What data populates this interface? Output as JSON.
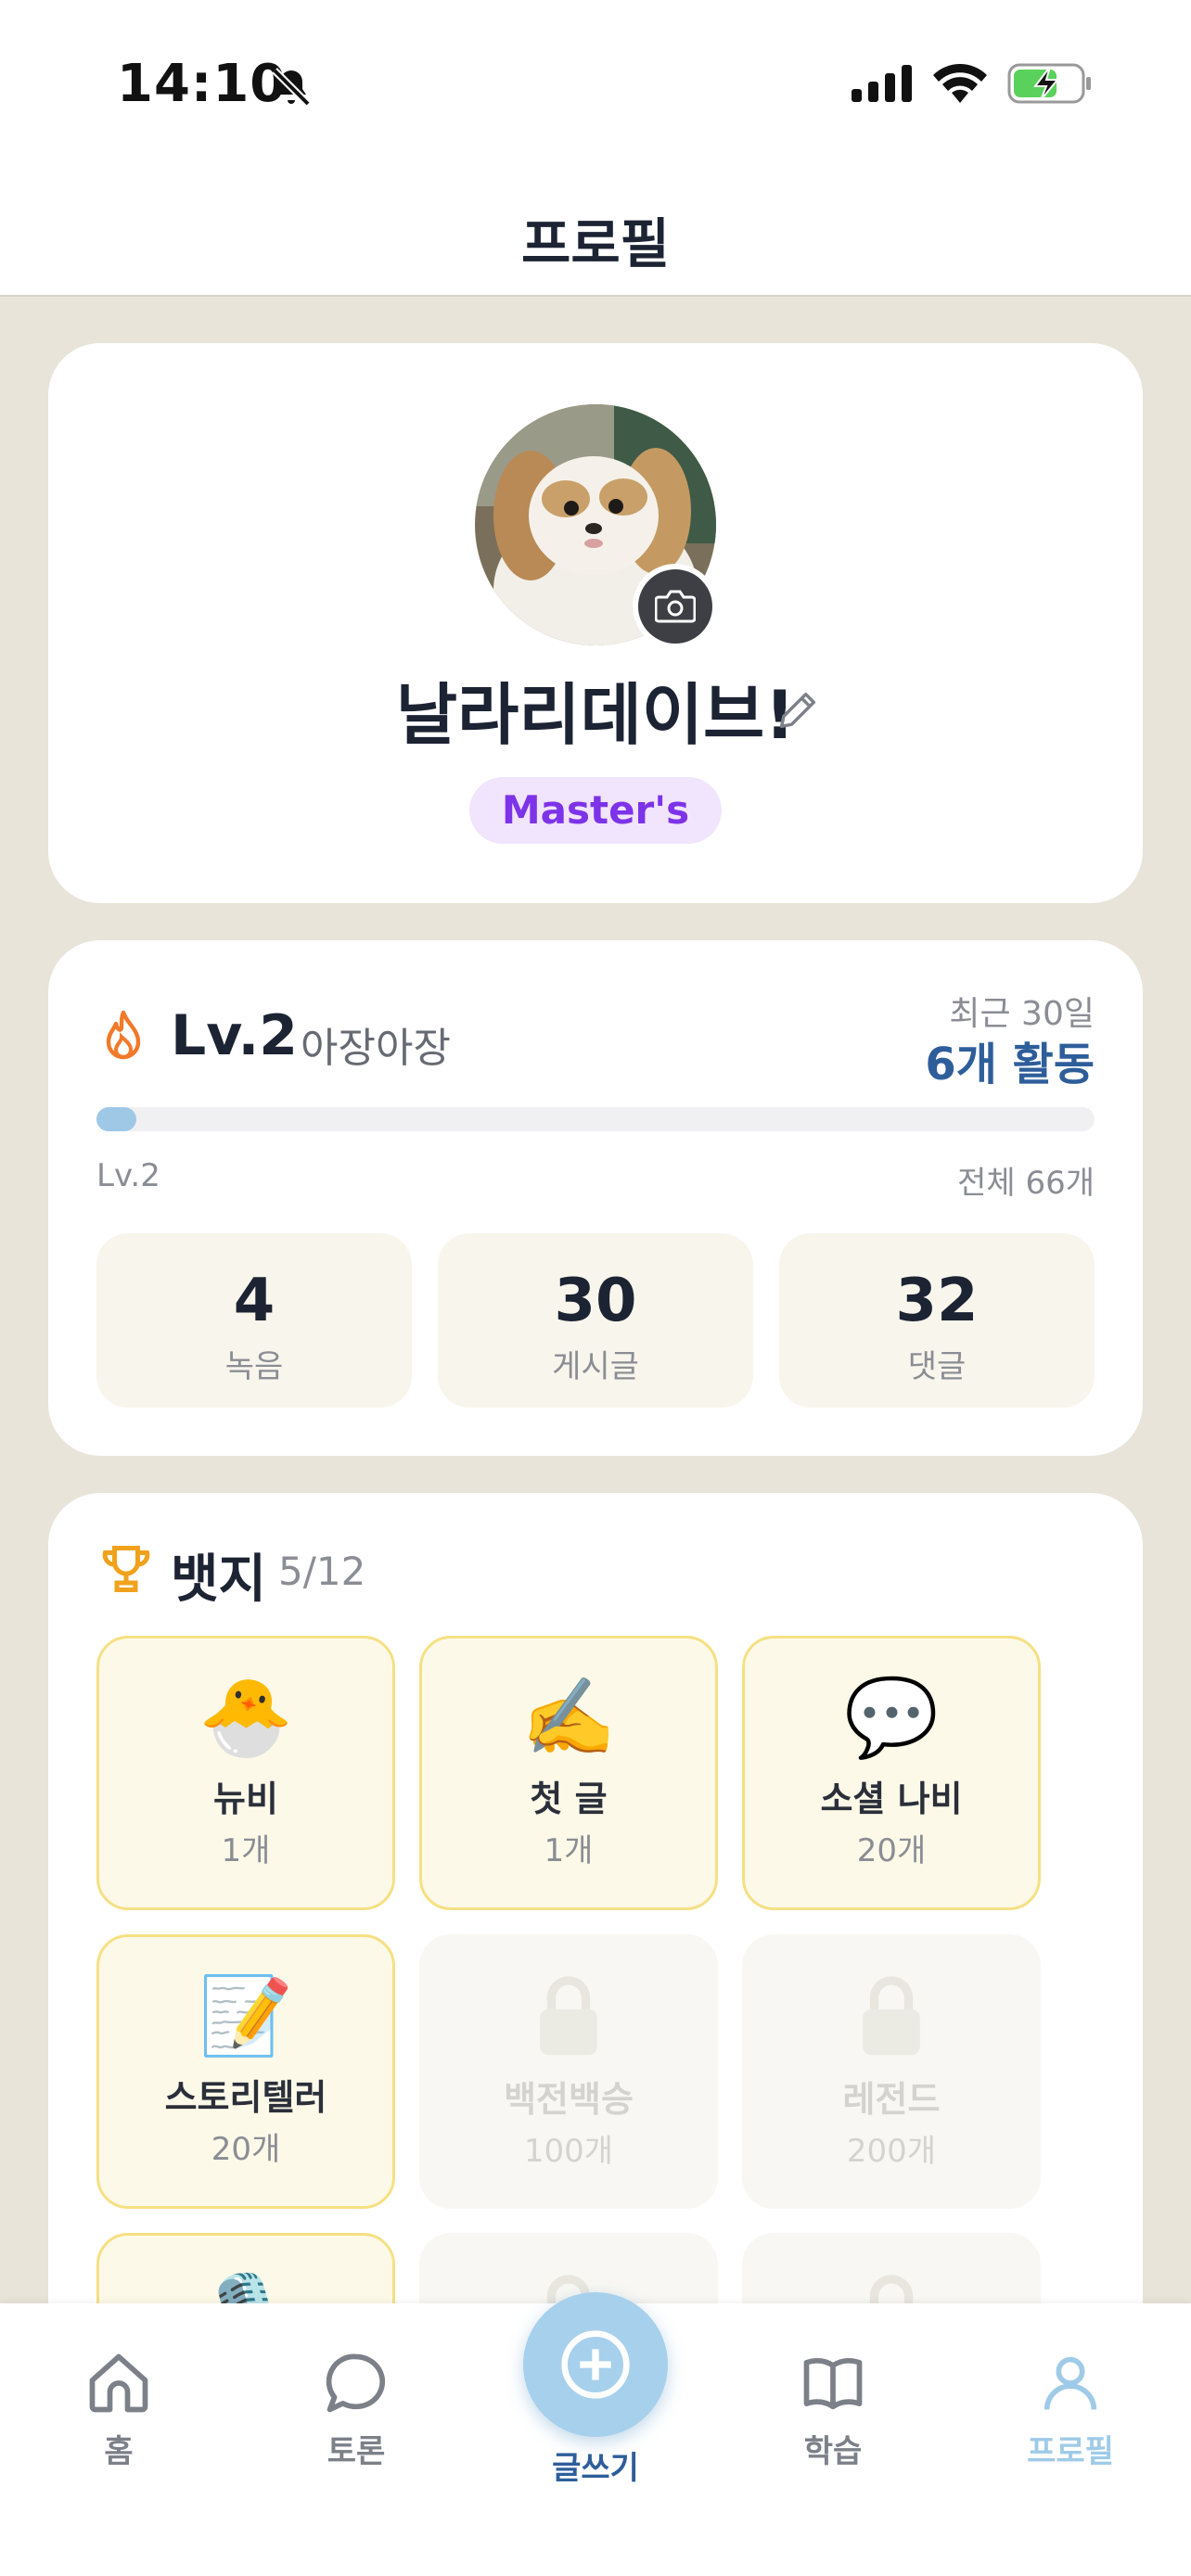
{
  "status_bar": {
    "time": "14:10"
  },
  "header": {
    "title": "프로필"
  },
  "profile": {
    "nickname": "날라리데이브!",
    "role_badge": "Master's"
  },
  "level": {
    "level": "Lv.2",
    "title": "아장아장",
    "recent_label": "최근 30일",
    "recent_activity": "6개 활동",
    "progress_fraction": 0.04,
    "level_caption": "Lv.2",
    "total": "전체 66개",
    "stats": [
      {
        "value": "4",
        "label": "녹음"
      },
      {
        "value": "30",
        "label": "게시글"
      },
      {
        "value": "32",
        "label": "댓글"
      }
    ]
  },
  "badges": {
    "title": "뱃지",
    "count": "5/12",
    "items": [
      {
        "emoji": "🐣",
        "name": "뉴비",
        "count": "1개",
        "unlocked": true
      },
      {
        "emoji": "✍️",
        "name": "첫 글",
        "count": "1개",
        "unlocked": true
      },
      {
        "emoji": "💬",
        "name": "소셜 나비",
        "count": "20개",
        "unlocked": true
      },
      {
        "emoji": "📝",
        "name": "스토리텔러",
        "count": "20개",
        "unlocked": true
      },
      {
        "emoji": "",
        "name": "백전백승",
        "count": "100개",
        "unlocked": false
      },
      {
        "emoji": "",
        "name": "레전드",
        "count": "200개",
        "unlocked": false
      },
      {
        "emoji": "🎙️",
        "name": "",
        "count": "",
        "unlocked": true
      },
      {
        "emoji": "",
        "name": "",
        "count": "",
        "unlocked": false
      },
      {
        "emoji": "",
        "name": "",
        "count": "",
        "unlocked": false
      }
    ]
  },
  "tabbar": {
    "home": "홈",
    "discuss": "토론",
    "write": "글쓰기",
    "learn": "학습",
    "profile": "프로필"
  },
  "colors": {
    "accent_blue": "#9fcbe8",
    "badge_purple": "#7d33e8",
    "activity_blue": "#2e5e9a"
  }
}
